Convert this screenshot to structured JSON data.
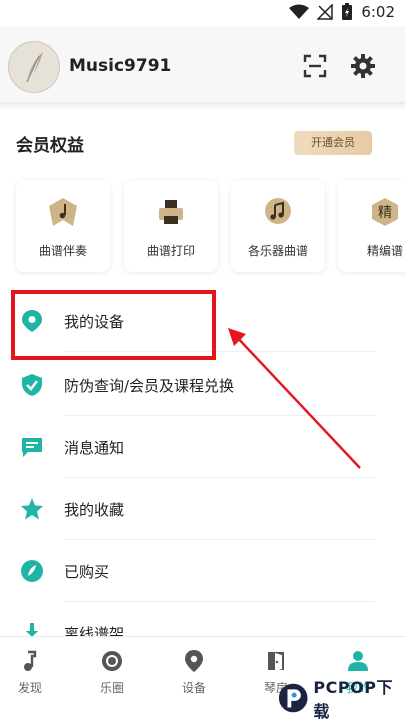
{
  "status_bar": {
    "time": "6:02"
  },
  "profile": {
    "username": "Music9791"
  },
  "membership": {
    "title": "会员权益",
    "open_vip_label": "开通会员",
    "cards": [
      {
        "label": "曲谱伴奏",
        "icon": "music-note-icon"
      },
      {
        "label": "曲谱打印",
        "icon": "printer-icon"
      },
      {
        "label": "各乐器曲谱",
        "icon": "music-note-icon"
      },
      {
        "label": "精编谱",
        "icon": "jing-badge-icon",
        "badge": "精"
      }
    ]
  },
  "menu": [
    {
      "label": "我的设备",
      "icon": "location-pin-icon"
    },
    {
      "label": "防伪查询/会员及课程兑换",
      "icon": "shield-check-icon"
    },
    {
      "label": "消息通知",
      "icon": "message-icon"
    },
    {
      "label": "我的收藏",
      "icon": "star-icon"
    },
    {
      "label": "已购买",
      "icon": "leaf-badge-icon"
    },
    {
      "label": "离线谱架",
      "icon": "download-icon"
    }
  ],
  "tabbar": [
    {
      "label": "发现",
      "icon": "music-note-icon",
      "active": false
    },
    {
      "label": "乐圈",
      "icon": "circle-target-icon",
      "active": false
    },
    {
      "label": "设备",
      "icon": "location-pin-icon",
      "active": false
    },
    {
      "label": "琴房",
      "icon": "door-icon",
      "active": false
    },
    {
      "label": "我的",
      "icon": "person-icon",
      "active": true
    }
  ],
  "watermark": {
    "text": "PCPOP下载"
  },
  "colors": {
    "accent": "#1fb5a5",
    "highlight": "#e8141b",
    "vip_gold": "#e6caa3"
  }
}
